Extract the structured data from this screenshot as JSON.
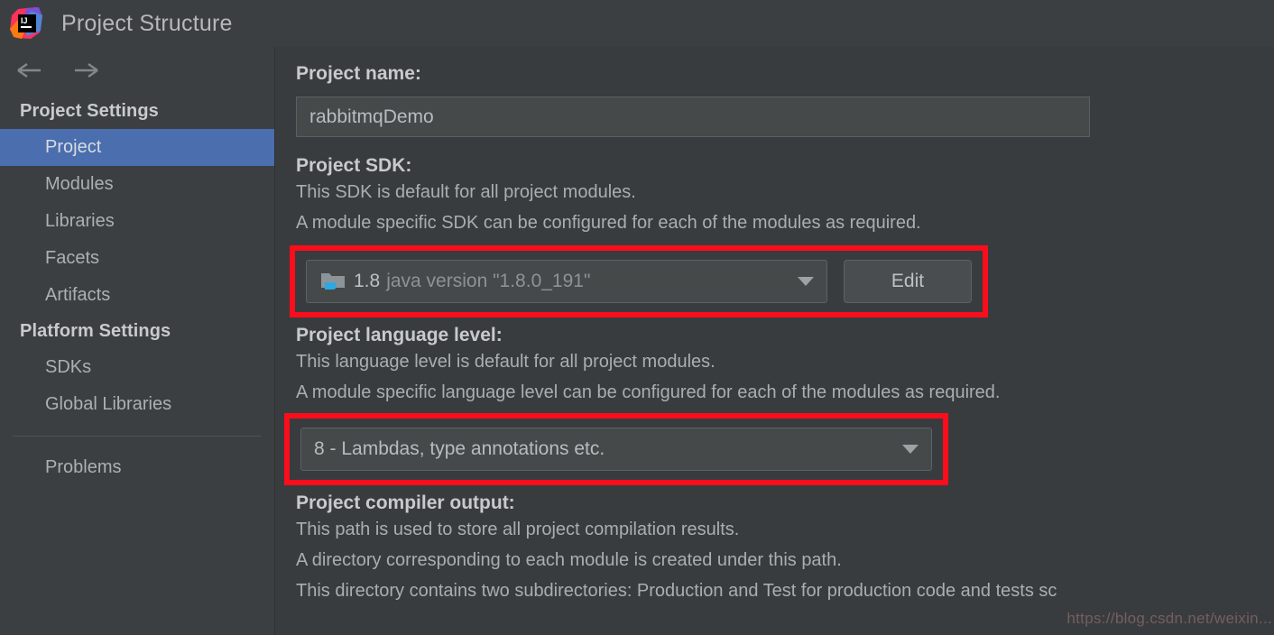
{
  "window": {
    "title": "Project Structure",
    "logo_icon": "intellij-idea-logo"
  },
  "nav": {
    "back_icon": "arrow-left-icon",
    "forward_icon": "arrow-right-icon"
  },
  "sidebar": {
    "groups": [
      {
        "header": "Project Settings",
        "items": [
          {
            "label": "Project",
            "selected": true
          },
          {
            "label": "Modules",
            "selected": false
          },
          {
            "label": "Libraries",
            "selected": false
          },
          {
            "label": "Facets",
            "selected": false
          },
          {
            "label": "Artifacts",
            "selected": false
          }
        ]
      },
      {
        "header": "Platform Settings",
        "items": [
          {
            "label": "SDKs",
            "selected": false
          },
          {
            "label": "Global Libraries",
            "selected": false
          }
        ]
      }
    ],
    "extra_items": [
      {
        "label": "Problems",
        "selected": false
      }
    ]
  },
  "main": {
    "project_name": {
      "label": "Project name:",
      "value": "rabbitmqDemo",
      "placeholder": "Project name"
    },
    "project_sdk": {
      "label": "Project SDK:",
      "desc_line1": "This SDK is default for all project modules.",
      "desc_line2": "A module specific SDK can be configured for each of the modules as required.",
      "sdk_icon": "jdk-folder-icon",
      "value_name": "1.8",
      "value_detail": "java version \"1.8.0_191\"",
      "dropdown_icon": "chevron-down-icon",
      "edit_button": "Edit",
      "highlighted": true
    },
    "project_language_level": {
      "label": "Project language level:",
      "desc_line1": "This language level is default for all project modules.",
      "desc_line2": "A module specific language level can be configured for each of the modules as required.",
      "value": "8 - Lambdas, type annotations etc.",
      "dropdown_icon": "chevron-down-icon",
      "highlighted": true
    },
    "project_compiler_output": {
      "label": "Project compiler output:",
      "desc_line1": "This path is used to store all project compilation results.",
      "desc_line2": "A directory corresponding to each module is created under this path.",
      "desc_line3": "This directory contains two subdirectories: Production and Test for production code and tests sc"
    }
  },
  "watermark": {
    "text": "https://blog.csdn.net/weixin..."
  },
  "colors": {
    "selection_blue": "#4b6eaf",
    "highlight_red": "#fc0d1b",
    "panel_bg": "#393c3e",
    "sidebar_bg": "#3c3f41",
    "field_bg": "#45494a"
  }
}
